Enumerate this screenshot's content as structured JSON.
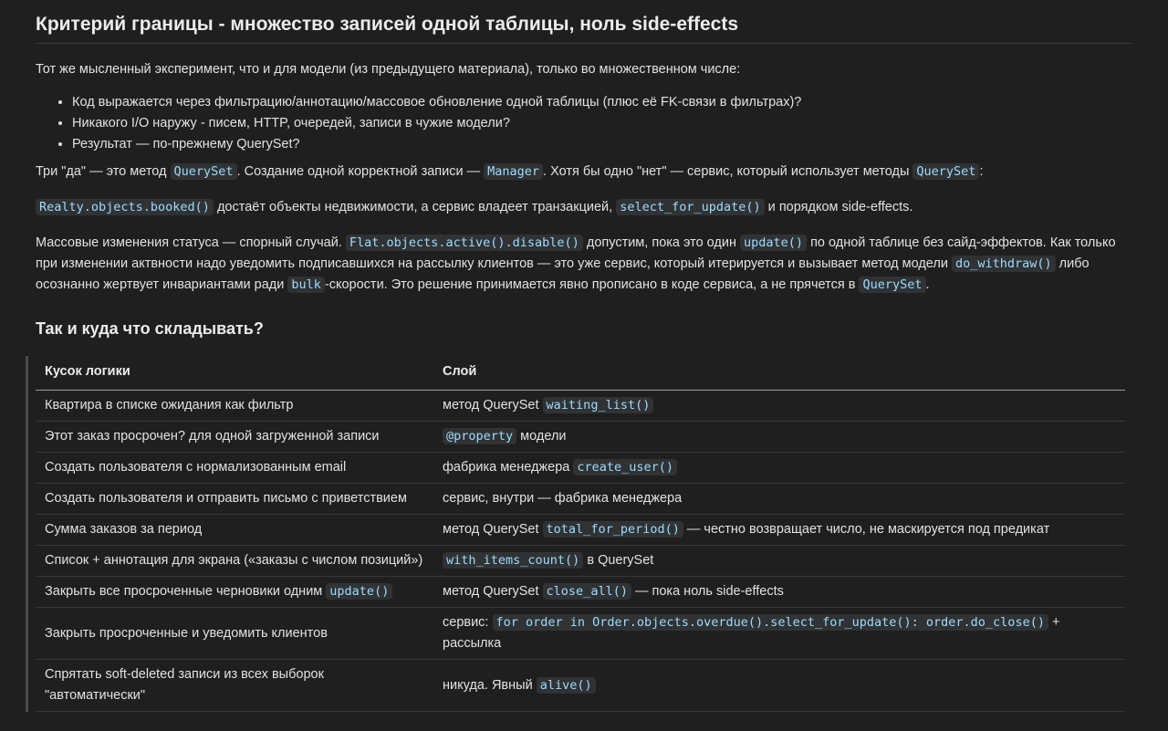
{
  "heading": "Критерий границы - множество записей одной таблицы, ноль side-effects",
  "intro": "Тот же мысленный эксперимент, что и для модели (из предыдущего материала), только во множественном числе:",
  "questions": [
    "Код выражается через фильтрацию/аннотацию/массовое обновление одной таблицы (плюс её FK-связи в фильтрах)?",
    "Никакого I/O наружу - писем, HTTP, очередей, записи в чужие модели?",
    "Результат — по-прежнему QuerySet?"
  ],
  "three_yes": {
    "t1": "Три \"да\" — это метод ",
    "c1": "QuerySet",
    "t2": ". Создание одной корректной записи — ",
    "c2": "Manager",
    "t3": ". Хотя бы одно \"нет\" — сервис, который использует методы ",
    "c3": "QuerySet",
    "t4": ":"
  },
  "realty": {
    "c1": "Realty.objects.booked()",
    "t1": " достаёт объекты недвижимости, а сервис владеет транзакцией, ",
    "c2": "select_for_update()",
    "t2": " и порядком side-effects."
  },
  "mass": {
    "t1": "Массовые изменения статуса — спорный случай. ",
    "c1": "Flat.objects.active().disable()",
    "t2": " допустим, пока это один ",
    "c2": "update()",
    "t3": " по одной таблице без сайд-эффектов. Как только при изменении актвности надо уведомить подписавшихся на рассылку клиентов — это уже сервис, который итерируется и вызывает метод модели ",
    "c3": "do_withdraw()",
    "t4": " либо осознанно жертвует инвариантами ради ",
    "c4": "bulk",
    "t5": "-скорости. Это решение принимается явно прописано в коде сервиса, а не прячется в ",
    "c5": "QuerySet",
    "t6": "."
  },
  "subheading": "Так и куда что складывать?",
  "table": {
    "headers": [
      "Кусок логики",
      "Слой"
    ],
    "rows": [
      {
        "logic": "Квартира в списке ожидания как фильтр",
        "l_code": "",
        "pre": "метод QuerySet ",
        "code": "waiting_list()",
        "post": ""
      },
      {
        "logic": "Этот заказ просрочен? для одной загруженной записи",
        "l_code": "",
        "pre": "",
        "code": "@property",
        "post": " модели"
      },
      {
        "logic": "Создать пользователя с нормализованным email",
        "l_code": "",
        "pre": "фабрика менеджера ",
        "code": "create_user()",
        "post": ""
      },
      {
        "logic": "Создать пользователя и отправить письмо с приветствием",
        "l_code": "",
        "pre": "сервис, внутри — фабрика менеджера",
        "code": "",
        "post": ""
      },
      {
        "logic": "Сумма заказов за период",
        "l_code": "",
        "pre": "метод QuerySet ",
        "code": "total_for_period()",
        "post": " — честно возвращает число, не маскируется под предикат"
      },
      {
        "logic": "Список + аннотация для экрана («заказы с числом позиций»)",
        "l_code": "",
        "pre": "",
        "code": "with_items_count()",
        "post": " в QuerySet"
      },
      {
        "logic": "Закрыть все просроченные черновики одним ",
        "l_code": "update()",
        "pre": "метод QuerySet ",
        "code": "close_all()",
        "post": " — пока ноль side-effects"
      },
      {
        "logic": "Закрыть просроченные и уведомить клиентов",
        "l_code": "",
        "pre": "сервис: ",
        "code": "for order in Order.objects.overdue().select_for_update(): order.do_close()",
        "post": " + рассылка"
      },
      {
        "logic": "Спрятать soft-deleted записи из всех выборок \"автоматически\"",
        "l_code": "",
        "pre": "никуда. Явный ",
        "code": "alive()",
        "post": ""
      }
    ]
  },
  "colors": {
    "background": "#1f1f1f",
    "text": "#e2e2e2",
    "code_text": "#9cdcfe",
    "code_bg": "#303234"
  }
}
